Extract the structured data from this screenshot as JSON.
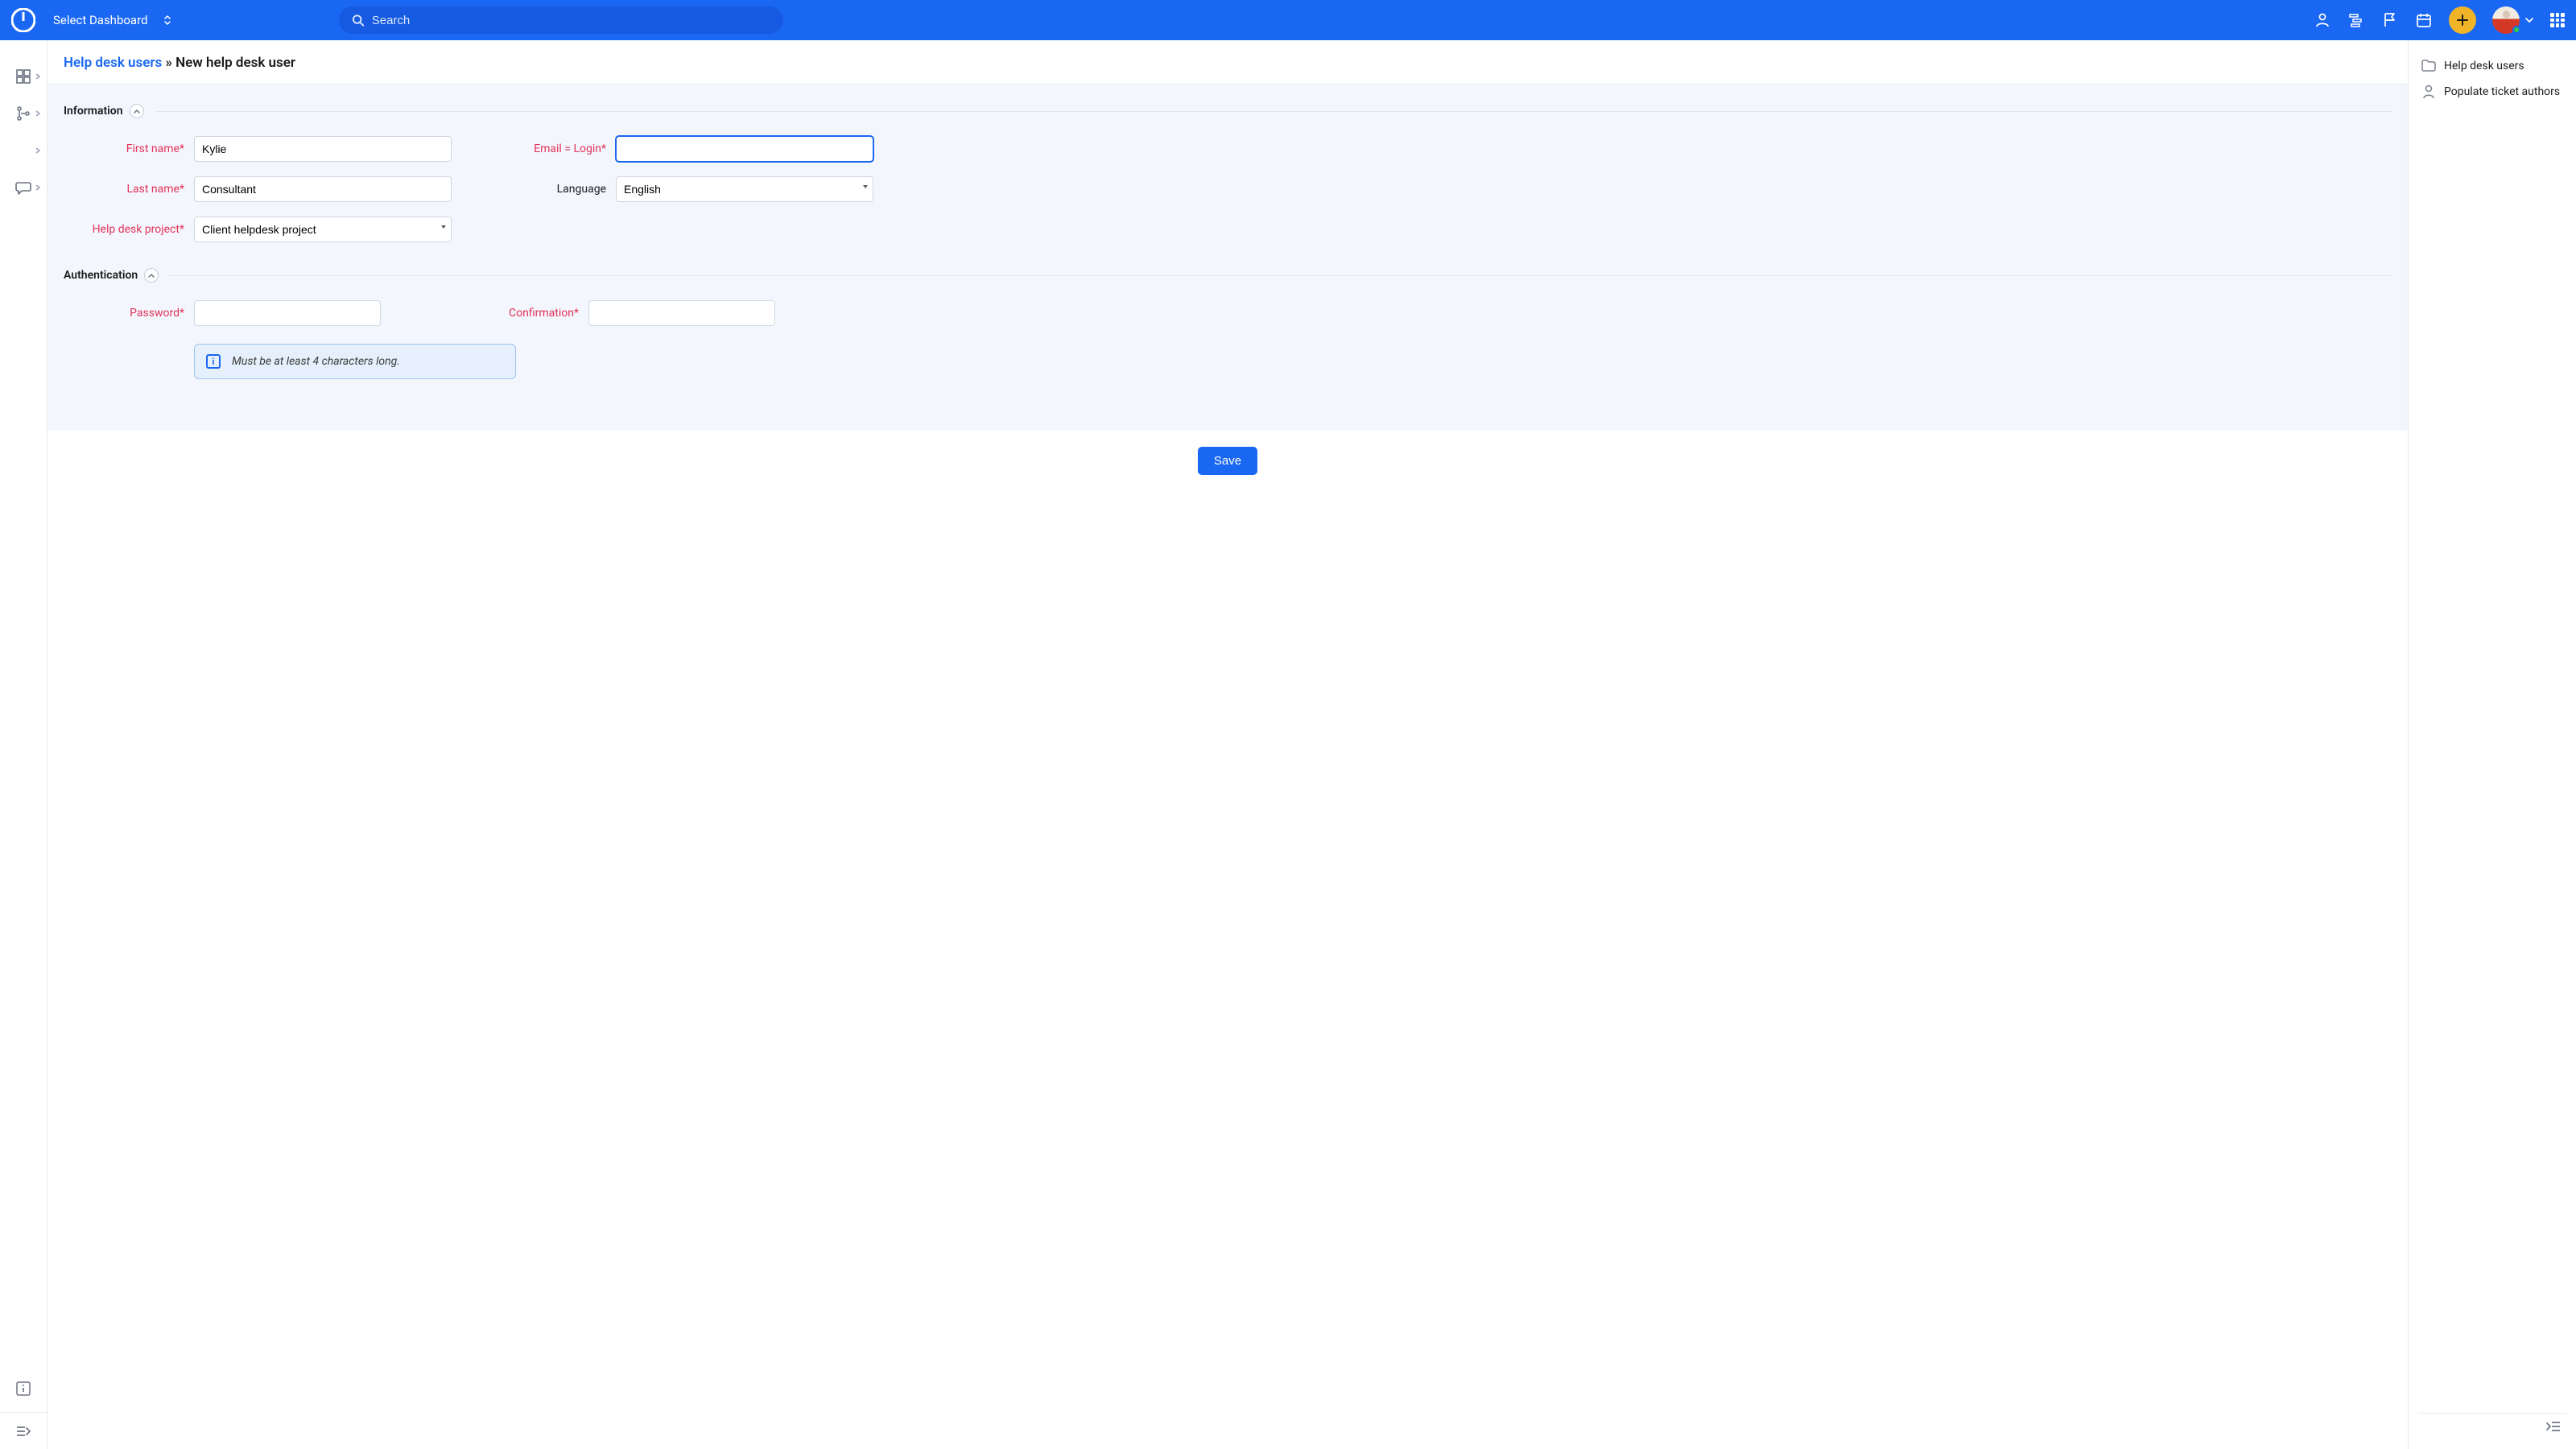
{
  "header": {
    "dashboard_label": "Select Dashboard",
    "search_placeholder": "Search"
  },
  "breadcrumb": {
    "link": "Help desk users",
    "sep": " » ",
    "current": "New help desk user"
  },
  "sections": {
    "info": "Information",
    "auth": "Authentication"
  },
  "form": {
    "first_name": {
      "label": "First name",
      "value": "Kylie"
    },
    "last_name": {
      "label": "Last name",
      "value": "Consultant"
    },
    "helpdesk_project": {
      "label": "Help desk project",
      "value": "Client helpdesk project"
    },
    "email": {
      "label": "Email = Login",
      "value": ""
    },
    "language": {
      "label": "Language",
      "value": "English"
    },
    "password": {
      "label": "Password",
      "value": ""
    },
    "confirmation": {
      "label": "Confirmation",
      "value": ""
    },
    "password_hint": "Must be at least 4 characters long."
  },
  "actions": {
    "save": "Save"
  },
  "right_panel": {
    "items": [
      "Help desk users",
      "Populate ticket authors"
    ]
  }
}
